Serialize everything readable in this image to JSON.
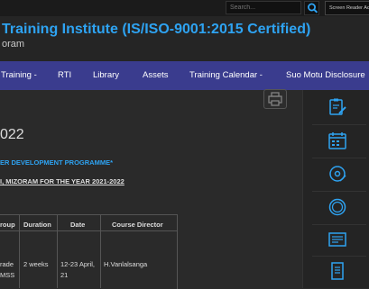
{
  "topbar": {
    "search_placeholder": "Search...",
    "screen_reader_label": "Screen Reader Access"
  },
  "header": {
    "title": "Training Institute (IS/ISO-9001:2015 Certified)",
    "subtitle": "oram"
  },
  "nav": {
    "items": [
      {
        "label": "Training -"
      },
      {
        "label": "RTI"
      },
      {
        "label": "Library"
      },
      {
        "label": "Assets"
      },
      {
        "label": "Training Calendar -"
      },
      {
        "label": "Suo Motu Disclosure"
      }
    ]
  },
  "main": {
    "heading": "022",
    "programme_title": "ER DEVELOPMENT PROGRAMME*",
    "programme_subtitle": "I, MIZORAM FOR THE YEAR 2021-2022",
    "table": {
      "headers": [
        "roup",
        "Duration",
        "Date",
        "Course Director"
      ],
      "rows": [
        {
          "group_line1": "rade",
          "group_line2": "MSS",
          "duration": "2 weeks",
          "date_line1": "12-23 April,",
          "date_line2": "21",
          "director": "H.Vanlalsanga"
        }
      ]
    }
  },
  "sidebar": {
    "icons": [
      "clipboard-edit-icon",
      "calendar-icon",
      "disc-icon",
      "circle-icon",
      "newspaper-icon",
      "document-icon"
    ]
  },
  "colors": {
    "nav_bg": "#3a3c8e",
    "title_blue": "#2ea3f2",
    "page_bg": "#2a2a2a"
  }
}
